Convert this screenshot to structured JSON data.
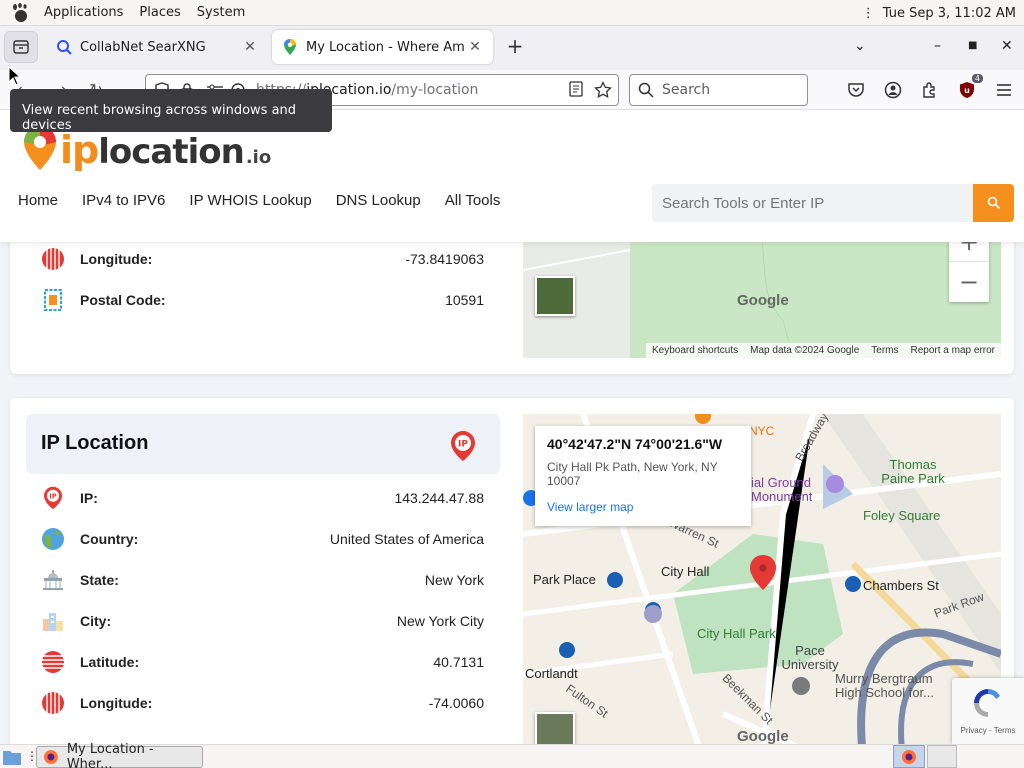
{
  "system_bar": {
    "menus": [
      "Applications",
      "Places",
      "System"
    ],
    "clock": "Tue Sep  3, 11:02 AM"
  },
  "browser": {
    "tabs": [
      {
        "title": "CollabNet SearXNG",
        "icon": "searxng-icon",
        "active": false
      },
      {
        "title": "My Location - Where Am I?",
        "icon": "maps-pin-icon",
        "active": true
      }
    ],
    "url_prefix": "https://",
    "url_host": "iplocation.io",
    "url_path": "/my-location",
    "search_placeholder": "Search",
    "tooltip": "View recent browsing across windows and devices",
    "extension_badge": "4"
  },
  "site": {
    "logo": {
      "ip": "ip",
      "location": "location",
      "tld": ".io"
    },
    "nav": [
      "Home",
      "IPv4 to IPV6",
      "IP WHOIS Lookup",
      "DNS Lookup",
      "All Tools"
    ],
    "search_placeholder": "Search Tools or Enter IP"
  },
  "card1": {
    "rows": [
      {
        "label": "Longitude:",
        "value": "-73.8419063",
        "icon": "globe-lines-icon"
      },
      {
        "label": "Postal Code:",
        "value": "10591",
        "icon": "postal-code-icon"
      }
    ],
    "map": {
      "attribution": [
        "Keyboard shortcuts",
        "Map data ©2024 Google",
        "Terms",
        "Report a map error"
      ],
      "google": "Google"
    }
  },
  "ip_location": {
    "title": "IP Location",
    "rows": [
      {
        "label": "IP:",
        "value": "143.244.47.88",
        "icon": "ip-pin-icon"
      },
      {
        "label": "Country:",
        "value": "United States of America",
        "icon": "earth-icon"
      },
      {
        "label": "State:",
        "value": "New York",
        "icon": "capitol-icon"
      },
      {
        "label": "City:",
        "value": "New York City",
        "icon": "city-icon"
      },
      {
        "label": "Latitude:",
        "value": "40.7131",
        "icon": "globe-lines-icon"
      },
      {
        "label": "Longitude:",
        "value": "-74.0060",
        "icon": "globe-lines-icon"
      }
    ],
    "map": {
      "coord": "40°42'47.2\"N 74°00'21.6\"W",
      "address": "City Hall Pk Path, New York, NY 10007",
      "link": "View larger map",
      "labels": [
        "NYC",
        "Thomas Paine Park",
        "Foley Square",
        "City Hall",
        "Chambers St",
        "Park Place",
        "City Hall Park",
        "Pace University",
        "Cortlandt",
        "Murry Bergtraum High School for...",
        "Park Row",
        "Fulton St",
        "Beekman St",
        "Broadway",
        "Warren St",
        "ial Ground Monument"
      ],
      "google": "Google"
    }
  },
  "recaptcha": "Privacy - Terms",
  "taskbar": {
    "task_title": "My Location - Wher..."
  },
  "colors": {
    "brand_orange": "#f5901e",
    "pin_red": "#e53935",
    "link_blue": "#1a73e8"
  }
}
